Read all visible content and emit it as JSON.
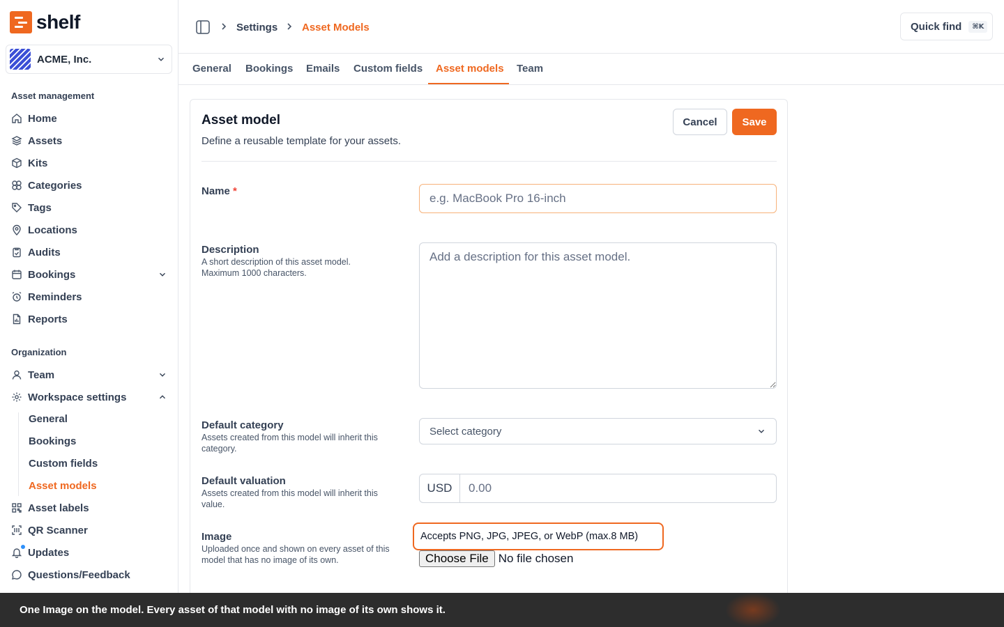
{
  "brand": {
    "name": "shelf",
    "accent": "#ef6820"
  },
  "org": {
    "name": "ACME, Inc."
  },
  "sidebar": {
    "sections": [
      {
        "label": "Asset management"
      },
      {
        "label": "Organization"
      }
    ],
    "items": [
      {
        "label": "Home",
        "icon": "home-icon"
      },
      {
        "label": "Assets",
        "icon": "cube-stack-icon"
      },
      {
        "label": "Kits",
        "icon": "package-icon"
      },
      {
        "label": "Categories",
        "icon": "shapes-icon"
      },
      {
        "label": "Tags",
        "icon": "tag-icon"
      },
      {
        "label": "Locations",
        "icon": "map-pin-icon"
      },
      {
        "label": "Audits",
        "icon": "clipboard-check-icon"
      },
      {
        "label": "Bookings",
        "icon": "calendar-icon"
      },
      {
        "label": "Reminders",
        "icon": "alarm-icon"
      },
      {
        "label": "Reports",
        "icon": "report-icon"
      },
      {
        "label": "Team",
        "icon": "user-icon"
      },
      {
        "label": "Workspace settings",
        "icon": "gear-icon"
      },
      {
        "label": "Asset labels",
        "icon": "qr-icon"
      },
      {
        "label": "QR Scanner",
        "icon": "scan-icon"
      },
      {
        "label": "Updates",
        "icon": "bell-icon"
      },
      {
        "label": "Questions/Feedback",
        "icon": "chat-icon"
      }
    ],
    "workspace_sub": [
      {
        "label": "General"
      },
      {
        "label": "Bookings"
      },
      {
        "label": "Custom fields"
      },
      {
        "label": "Asset models"
      }
    ]
  },
  "header": {
    "breadcrumb": [
      "Settings",
      "Asset Models"
    ],
    "quick_find": "Quick find",
    "shortcut": "⌘K"
  },
  "tabs": [
    "General",
    "Bookings",
    "Emails",
    "Custom fields",
    "Asset models",
    "Team"
  ],
  "active_tab": "Asset models",
  "form": {
    "title": "Asset model",
    "subtitle": "Define a reusable template for your assets.",
    "cancel": "Cancel",
    "save": "Save",
    "name": {
      "label": "Name",
      "required_mark": "*",
      "placeholder": "e.g. MacBook Pro 16-inch"
    },
    "description": {
      "label": "Description",
      "help": "A short description of this asset model. Maximum 1000 characters.",
      "placeholder": "Add a description for this asset model."
    },
    "category": {
      "label": "Default category",
      "help": "Assets created from this model will inherit this category.",
      "placeholder": "Select category"
    },
    "valuation": {
      "label": "Default valuation",
      "help": "Assets created from this model will inherit this value.",
      "currency": "USD",
      "placeholder": "0.00"
    },
    "image": {
      "label": "Image",
      "help": "Uploaded once and shown on every asset of this model that has no image of its own.",
      "accepts": "Accepts PNG, JPG, JPEG, or WebP (max.8 MB)",
      "choose": "Choose File",
      "status": "No file chosen"
    }
  },
  "toast": {
    "text": "One Image on the model. Every asset of that model with no image of its own shows it."
  }
}
